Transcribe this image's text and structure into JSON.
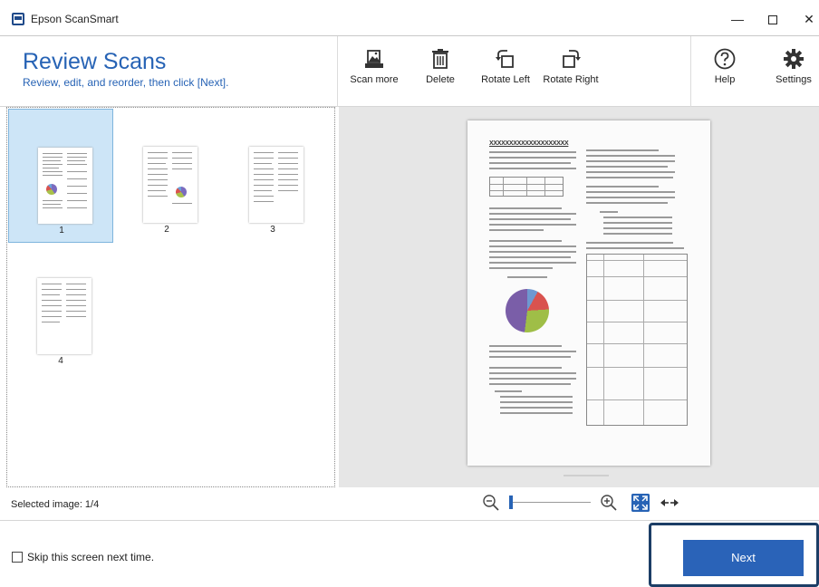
{
  "window": {
    "title": "Epson ScanSmart",
    "minimize_glyph": "—",
    "close_glyph": "✕"
  },
  "header": {
    "title": "Review Scans",
    "subtitle": "Review, edit, and reorder, then click [Next]."
  },
  "toolbar": {
    "scan_more": "Scan more",
    "delete": "Delete",
    "rotate_left": "Rotate Left",
    "rotate_right": "Rotate Right",
    "help": "Help",
    "settings": "Settings"
  },
  "thumbnails": [
    {
      "number": "1",
      "selected": true
    },
    {
      "number": "2",
      "selected": false
    },
    {
      "number": "3",
      "selected": false
    },
    {
      "number": "4",
      "selected": false
    }
  ],
  "status": {
    "selected_image": "Selected image: 1/4"
  },
  "preview": {
    "doc_title": "XXXXXXXXXXXXXXXXXXXX"
  },
  "footer": {
    "skip_label": "Skip this screen next time.",
    "skip_checked": false,
    "next_label": "Next"
  },
  "colors": {
    "accent": "#2763b5",
    "next_button": "#2a63b8",
    "selected_thumb": "#cde5f7",
    "preview_bg": "#e6e6e6"
  },
  "icons": {
    "app": "scanner-app-icon",
    "scan_more": "scan-more-icon",
    "delete": "trash-icon",
    "rotate_left": "rotate-left-icon",
    "rotate_right": "rotate-right-icon",
    "help": "help-circle-icon",
    "settings": "gear-icon",
    "zoom_out": "zoom-out-icon",
    "zoom_in": "zoom-in-icon",
    "fit": "fit-to-window-icon",
    "fit_width": "fit-width-icon"
  }
}
